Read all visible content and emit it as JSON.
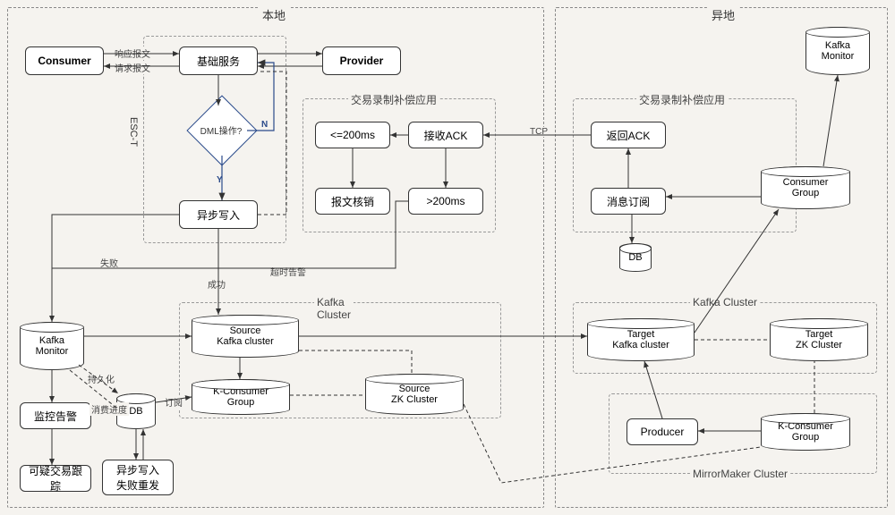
{
  "regions": {
    "local": "本地",
    "remote": "异地"
  },
  "subregions": {
    "esc_t": "ESC-T",
    "txn_comp_local": "交易录制补偿应用",
    "txn_comp_remote": "交易录制补偿应用",
    "kafka_cluster_local": "Kafka\nCluster",
    "kafka_cluster_remote": "Kafka Cluster",
    "mirrormaker": "MirrorMaker Cluster"
  },
  "boxes": {
    "consumer": "Consumer",
    "base_service": "基础服务",
    "provider": "Provider",
    "dml_op": "DML操作?",
    "async_write": "异步写入",
    "le200ms": "<=200ms",
    "recv_ack": "接收ACK",
    "msg_verify": "报文核销",
    "gt200ms": ">200ms",
    "return_ack": "返回ACK",
    "msg_sub": "消息订阅",
    "monitor_alert": "监控告警",
    "suspect_track": "可疑交易跟踪",
    "async_fail_resend": "异步写入\n失败重发",
    "producer": "Producer"
  },
  "cylinders": {
    "kafka_monitor_local": "Kafka\nMonitor",
    "kafka_monitor_remote": "Kafka\nMonitor",
    "db_local": "DB",
    "db_remote": "DB",
    "source_kafka": "Source\nKafka cluster",
    "k_consumer_local": "K-Consumer\nGroup",
    "source_zk": "Source\nZK Cluster",
    "target_kafka": "Target\nKafka cluster",
    "target_zk": "Target\nZK Cluster",
    "consumer_group": "Consumer\nGroup",
    "k_consumer_remote": "K-Consumer\nGroup"
  },
  "edge_labels": {
    "resp_msg": "响应报文",
    "req_msg": "请求报文",
    "n": "N",
    "y": "Y",
    "fail": "失败",
    "success": "成功",
    "timeout_alert": "超时告警",
    "tcp": "TCP",
    "persist": "持久化",
    "consume_progress": "消费进度",
    "subscribe": "订阅"
  }
}
